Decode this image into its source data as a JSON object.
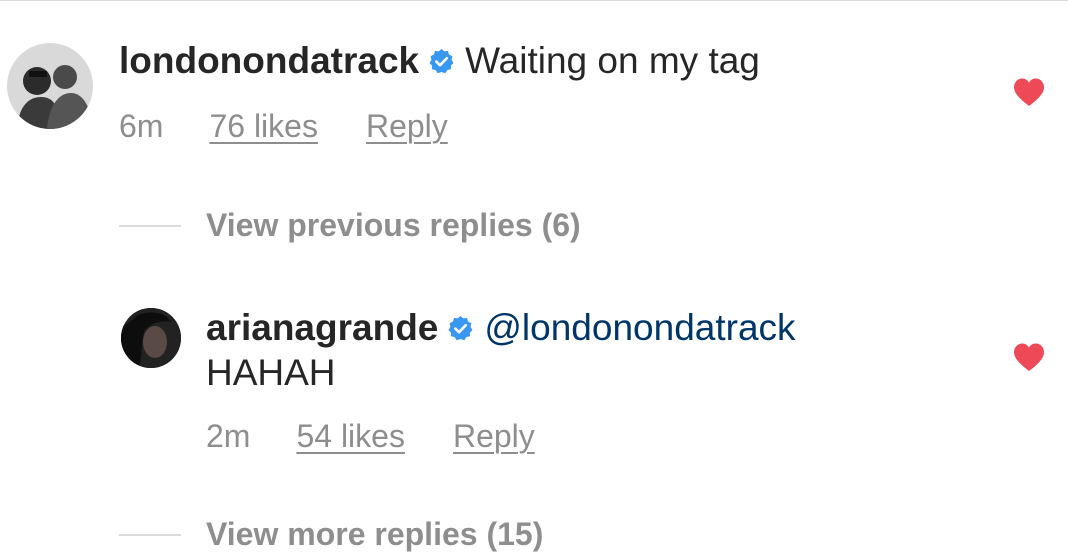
{
  "comment": {
    "username": "londonondatrack",
    "text": "Waiting on my tag",
    "time": "6m",
    "likes": "76 likes",
    "reply_label": "Reply",
    "liked": true
  },
  "view_previous": {
    "label": "View previous replies (6)"
  },
  "reply": {
    "username": "arianagrande",
    "mention": "@londonondatrack",
    "text": "HAHAH",
    "time": "2m",
    "likes": "54 likes",
    "reply_label": "Reply",
    "liked": true
  },
  "view_more": {
    "label": "View more replies (15)"
  },
  "colors": {
    "heart": "#ed4956",
    "verified": "#3897f0",
    "mention": "#003569",
    "secondary_text": "#8e8e8e"
  },
  "icons": {
    "verified": "verified-badge-icon",
    "like": "heart-icon"
  }
}
